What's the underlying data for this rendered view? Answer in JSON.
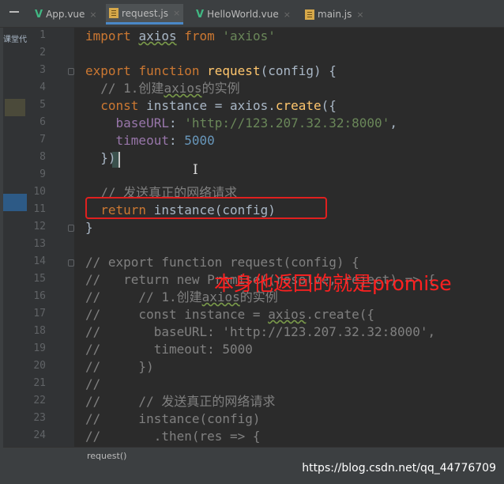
{
  "tabs": [
    {
      "label": "App.vue",
      "icon": "vue-file-icon",
      "close": "×"
    },
    {
      "label": "request.js",
      "icon": "js-file-icon",
      "close": "×",
      "active": true
    },
    {
      "label": "HelloWorld.vue",
      "icon": "vue-file-icon",
      "close": "×"
    },
    {
      "label": "main.js",
      "icon": "js-file-icon",
      "close": "×"
    }
  ],
  "sidebar_label": "课堂代",
  "line_numbers": [
    "1",
    "2",
    "3",
    "4",
    "5",
    "6",
    "7",
    "8",
    "9",
    "10",
    "11",
    "12",
    "13",
    "14",
    "15",
    "16",
    "17",
    "18",
    "19",
    "20",
    "21",
    "22",
    "23",
    "24"
  ],
  "code": {
    "l1": {
      "import": "import",
      "name": "axios",
      "from": "from",
      "module": "'axios'"
    },
    "l3": {
      "export": "export",
      "function": "function",
      "name": "request",
      "params": "(config) {"
    },
    "l4": {
      "comment_a": "// 1.创建",
      "comment_b": "axios",
      "comment_c": "的实例"
    },
    "l5": {
      "const": "const",
      "rest": "instance = axios.",
      "method": "create",
      "tail": "({"
    },
    "l6": {
      "key": "baseURL",
      "colon": ": ",
      "value": "'http://123.207.32.32:8000'",
      "comma": ","
    },
    "l7": {
      "key": "timeout",
      "colon": ": ",
      "value": "5000"
    },
    "l8": {
      "text": "})"
    },
    "l10": {
      "comment": "// 发送真正的网络请求"
    },
    "l11": {
      "return": "return",
      "rest": "instance(config)"
    },
    "l12": {
      "text": "}"
    },
    "l14": {
      "text": "// export function request(config) {"
    },
    "l15": {
      "text": "//   return new Promise((resolve, reject) => {"
    },
    "l16": {
      "a": "//     // 1.创建",
      "b": "axios",
      "c": "的实例"
    },
    "l17": {
      "a": "//     const instance = ",
      "b": "axios",
      "c": ".create({"
    },
    "l18": {
      "text": "//       baseURL: 'http://123.207.32.32:8000',"
    },
    "l19": {
      "text": "//       timeout: 5000"
    },
    "l20": {
      "text": "//     })"
    },
    "l21": {
      "text": "//"
    },
    "l22": {
      "text": "//     // 发送真正的网络请求"
    },
    "l23": {
      "text": "//     instance(config)"
    },
    "l24": {
      "text": "//       .then(res => {"
    }
  },
  "annotation": "本身他返回的就是promise",
  "status": "request()",
  "watermark": "https://blog.csdn.net/qq_44776709",
  "colors": {
    "keyword": "#cc7832",
    "function": "#ffc66d",
    "string": "#6a8759",
    "number": "#6897bb",
    "property": "#9876aa",
    "comment": "#808080",
    "annotation": "#ff2020"
  }
}
